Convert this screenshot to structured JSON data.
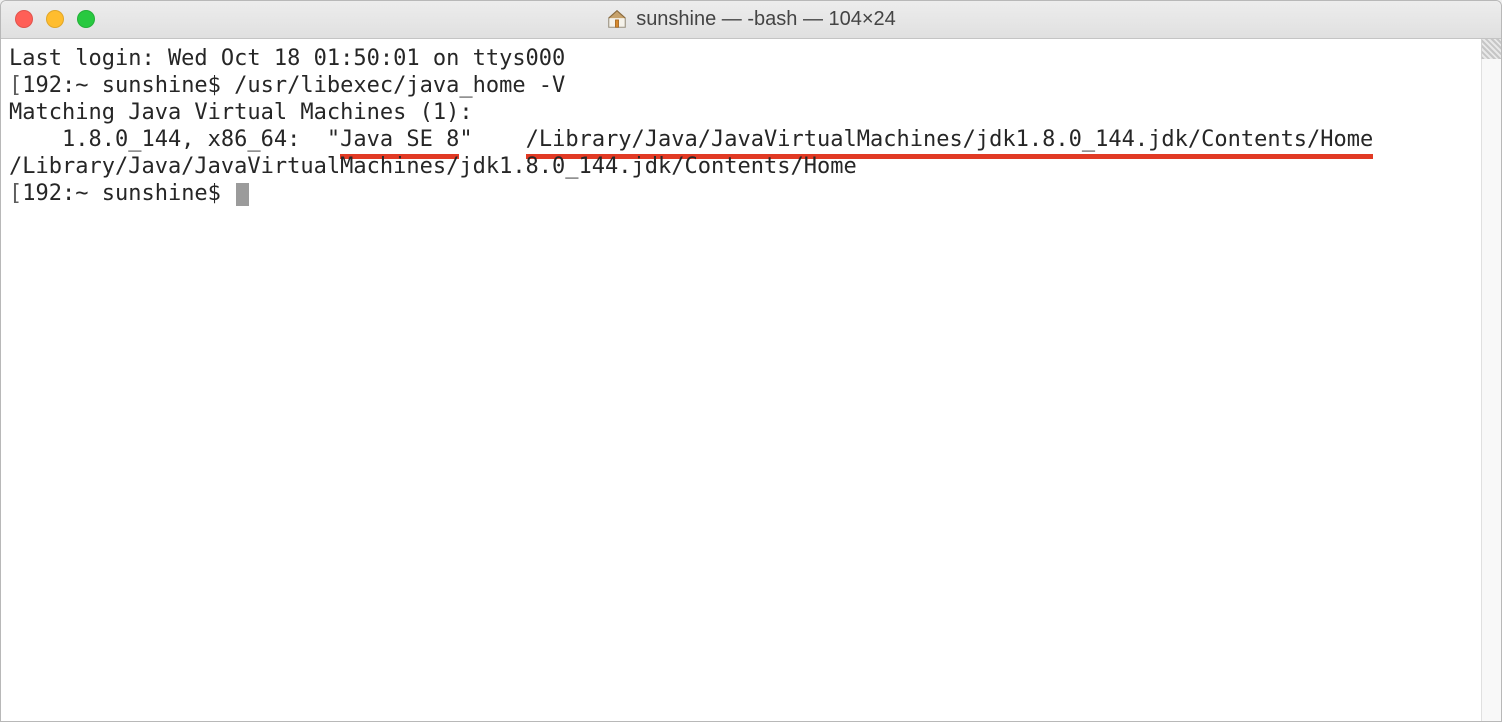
{
  "window": {
    "title": "sunshine — -bash — 104×24"
  },
  "terminal": {
    "line1": "Last login: Wed Oct 18 01:50:01 on ttys000",
    "line2_prompt": "192:~ sunshine$ ",
    "line2_cmd": "/usr/libexec/java_home -V",
    "line3": "Matching Java Virtual Machines (1):",
    "line4_pre": "    1.8.0_144, x86_64:  \"",
    "line4_u1": "Java SE 8",
    "line4_mid": "\"    ",
    "line4_u2": "/Library/Java/JavaVirtualMachines/jdk1.8.0_144.jdk/Contents/Home",
    "line5": "",
    "line6": "/Library/Java/JavaVirtualMachines/jdk1.8.0_144.jdk/Contents/Home",
    "line7_prompt": "192:~ sunshine$ "
  },
  "colors": {
    "underline": "#e13a24"
  }
}
